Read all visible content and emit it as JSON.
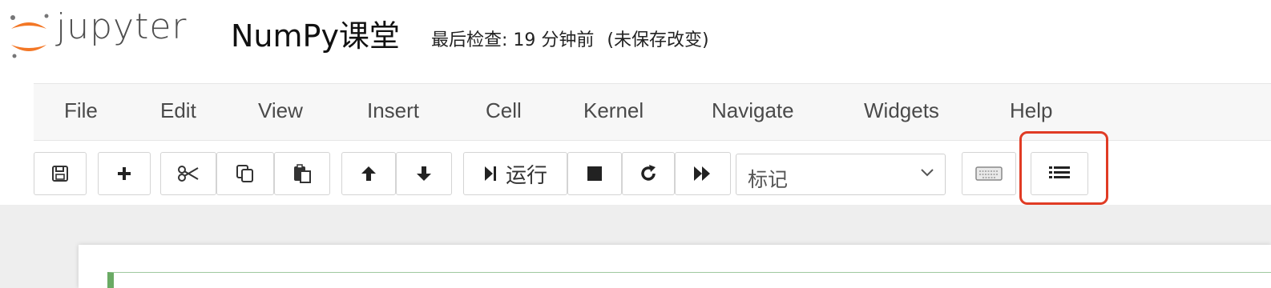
{
  "header": {
    "logo_text": "jupyter",
    "notebook_title": "NumPy课堂",
    "checkpoint_text": "最后检查: 19 分钟前",
    "save_status": "(未保存改变)"
  },
  "menubar": {
    "items": [
      "File",
      "Edit",
      "View",
      "Insert",
      "Cell",
      "Kernel",
      "Navigate",
      "Widgets",
      "Help"
    ]
  },
  "toolbar": {
    "buttons": [
      "save-icon",
      "plus-icon",
      "cut-icon",
      "copy-icon",
      "paste-icon",
      "arrow-up-icon",
      "arrow-down-icon",
      "run-icon",
      "stop-icon",
      "restart-icon",
      "fast-forward-icon",
      "keyboard-icon",
      "list-icon"
    ],
    "run_label": "运行",
    "cell_type": "标记",
    "highlight_color": "#e03b24"
  },
  "colors": {
    "logo_orange": "#f37726",
    "menubar_bg": "#f7f7f7",
    "cell_accent": "#6aaa64"
  }
}
